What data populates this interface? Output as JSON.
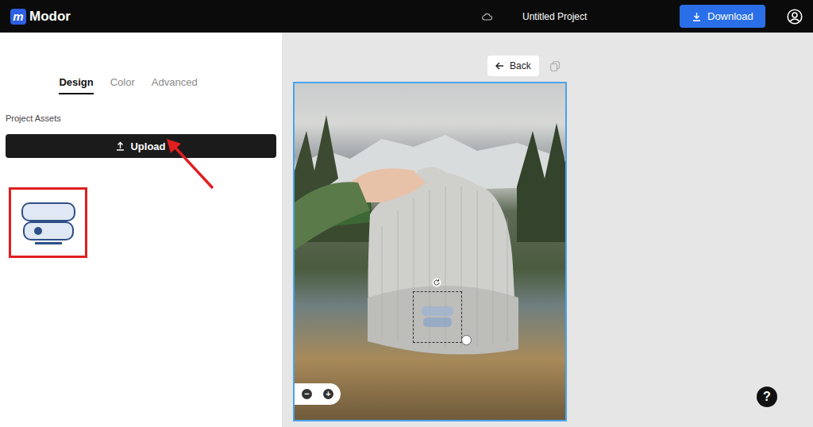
{
  "app": {
    "logo": "m",
    "name": "Modor"
  },
  "project": {
    "title": "Untitled Project"
  },
  "download_button": {
    "label": "Download"
  },
  "tabs": [
    {
      "label": "Design",
      "selected": true
    },
    {
      "label": "Color",
      "selected": false
    },
    {
      "label": "Advanced",
      "selected": false
    }
  ],
  "assets": {
    "heading": "Project Assets",
    "upload_label": "Upload",
    "items": [
      {
        "selected": true
      }
    ]
  },
  "back_button": {
    "label": "Back"
  },
  "zoom": {
    "out": "−",
    "in": "+"
  },
  "help": {
    "label": "?"
  }
}
